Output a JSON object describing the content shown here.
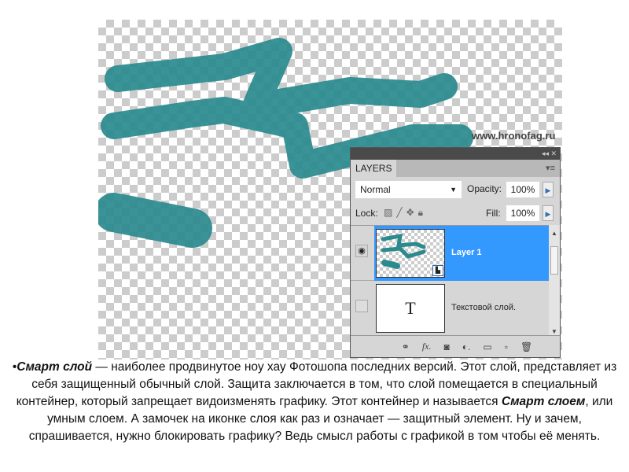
{
  "watermark": "www.hronofag.ru",
  "panel": {
    "controls": "◂◂ ✕",
    "tab": "LAYERS",
    "menu_icon": "▾≡",
    "blend_mode": "Normal",
    "opacity_label": "Opacity:",
    "opacity_value": "100%",
    "lock_label": "Lock:",
    "fill_label": "Fill:",
    "fill_value": "100%",
    "layers": [
      {
        "name": "Layer 1",
        "visible": true,
        "selected": true,
        "smart_object": true
      },
      {
        "name": "Текстовой слой.",
        "visible": false,
        "selected": false,
        "thumb_glyph": "T"
      }
    ],
    "footer_icons": [
      "link-icon",
      "fx-icon",
      "mask-icon",
      "adjustment-icon",
      "folder-icon",
      "new-layer-icon",
      "trash-icon"
    ]
  },
  "colors": {
    "stroke": "#2a8a8e",
    "selected": "#3399ff"
  },
  "caption": {
    "bullet": "•",
    "term": "Смарт слой",
    "t1": " — наиболее продвинутое ноу хау Фотошопа последних версий. Этот слой, представляет из себя защищенный обычный слой. Защита заключается в том, что слой помещается в специальный контейнер, который запрещает видоизменять графику. Этот контейнер и называется ",
    "term2": "Смарт слоем",
    "t2": ", или умным слоем. А замочек на иконке слоя как раз и означает — защитный элемент. Ну и зачем, спрашивается, нужно блокировать графику? Ведь смысл работы с графикой в том чтобы её менять."
  }
}
